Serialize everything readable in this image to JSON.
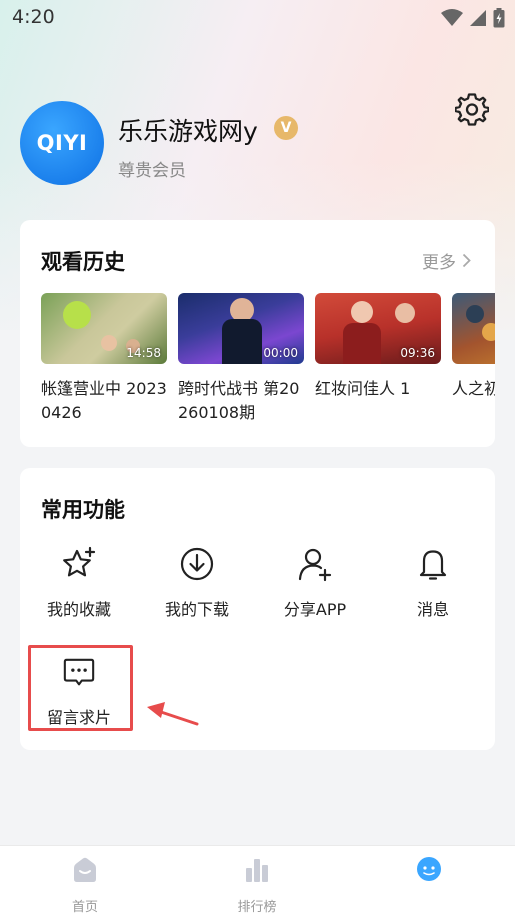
{
  "status_bar": {
    "time": "4:20"
  },
  "profile": {
    "avatar_text": "QIYI",
    "username": "乐乐游戏网y",
    "vip_badge": "V",
    "member_level": "尊贵会员"
  },
  "history": {
    "title": "观看历史",
    "more_label": "更多",
    "items": [
      {
        "label": "帐篷营业中 20230426",
        "duration": "14:58"
      },
      {
        "label": "跨时代战书 第20260108期",
        "duration": "00:00"
      },
      {
        "label": "红妆问佳人 1",
        "duration": "09:36"
      },
      {
        "label": "人之初 看版",
        "duration": ""
      }
    ]
  },
  "functions": {
    "title": "常用功能",
    "items": [
      {
        "label": "我的收藏",
        "icon": "star-plus-icon"
      },
      {
        "label": "我的下载",
        "icon": "download-icon"
      },
      {
        "label": "分享APP",
        "icon": "user-add-icon"
      },
      {
        "label": "消息",
        "icon": "bell-icon"
      },
      {
        "label": "留言求片",
        "icon": "message-dots-icon"
      }
    ]
  },
  "bottom_nav": {
    "items": [
      {
        "label": "首页",
        "icon": "home-icon"
      },
      {
        "label": "排行榜",
        "icon": "ranking-icon"
      },
      {
        "label": "",
        "icon": "profile-face-icon"
      }
    ]
  },
  "colors": {
    "accent": "#1b80ec",
    "annotation": "#e74c4c",
    "vip": "#e7b86a",
    "nav_active": "#3aa6ff"
  }
}
